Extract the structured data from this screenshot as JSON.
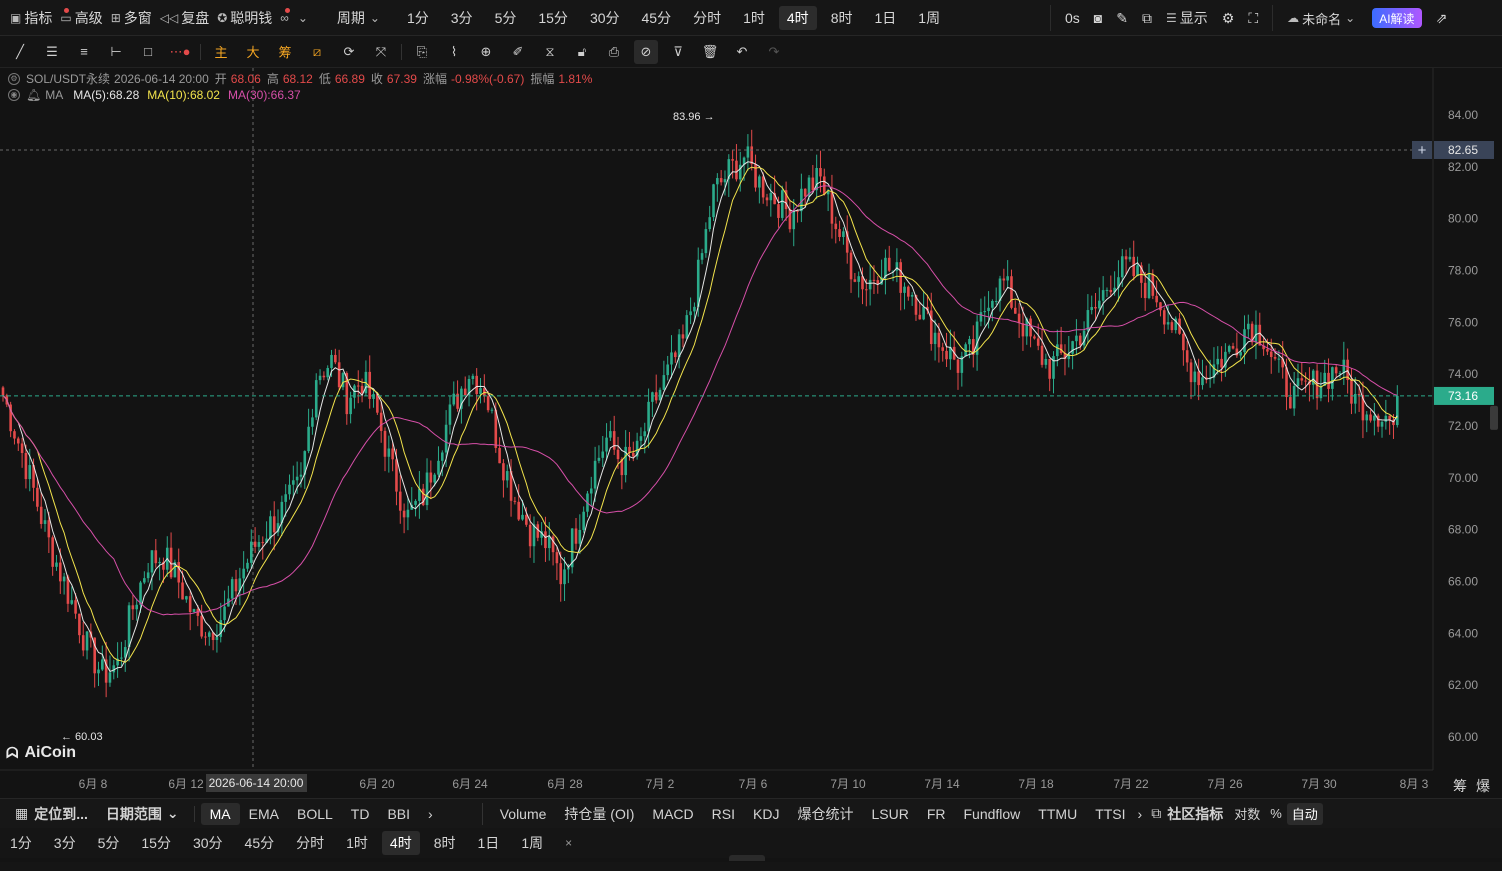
{
  "toolbar": {
    "items": [
      {
        "label": "指标",
        "icon": "indicator-icon",
        "dot": true
      },
      {
        "label": "高级",
        "icon": "advanced-icon",
        "dot": false
      },
      {
        "label": "多窗",
        "icon": "multi-window-icon",
        "dot": false
      },
      {
        "label": "复盘",
        "icon": "replay-icon",
        "dot": false
      },
      {
        "label": "聪明钱",
        "icon": "smart-money-icon",
        "dot": true
      }
    ],
    "periods_label": "周期",
    "periods": [
      "1分",
      "3分",
      "5分",
      "15分",
      "30分",
      "45分",
      "分时",
      "1时",
      "4时",
      "8时",
      "1日",
      "1周"
    ],
    "active_period": "4时",
    "countdown": "0s",
    "display_label": "显示",
    "layout_name": "未命名",
    "ai_label": "AI解读"
  },
  "legend": {
    "symbol": "SOL/USDT永续",
    "datetime": "2026-06-14 20:00",
    "open_label": "开",
    "open": "68.06",
    "high_label": "高",
    "high": "68.12",
    "low_label": "低",
    "low": "66.89",
    "close_label": "收",
    "close": "67.39",
    "change_label": "涨幅",
    "change": "-0.98%(-0.67)",
    "amp_label": "振幅",
    "amp": "1.81%",
    "ma_name": "MA",
    "ma5": "MA(5):68.28",
    "ma10": "MA(10):68.02",
    "ma30": "MA(30):66.37"
  },
  "chart_data": {
    "type": "candlestick",
    "symbol": "SOL/USDT永续",
    "interval": "4时",
    "ylim": [
      59,
      85
    ],
    "y_ticks": [
      "84.00",
      "82.00",
      "80.00",
      "78.00",
      "76.00",
      "74.00",
      "72.00",
      "70.00",
      "68.00",
      "66.00",
      "64.00",
      "62.00",
      "60.00"
    ],
    "x_ticks": [
      "6月 8",
      "6月 12",
      "6月 20",
      "6月 24",
      "6月 28",
      "7月 2",
      "7月 6",
      "7月 10",
      "7月 14",
      "7月 18",
      "7月 22",
      "7月 26",
      "7月 30",
      "8月 3"
    ],
    "crosshair_label": "2026-06-14 20:00",
    "crosshair_price": "82.65",
    "last_price": "73.16",
    "max_label": "83.96",
    "min_label": "60.03",
    "close_path": [
      [
        0,
        73.2
      ],
      [
        6,
        70.5
      ],
      [
        12,
        67.5
      ],
      [
        18,
        65.2
      ],
      [
        22,
        63.5
      ],
      [
        26,
        62.4
      ],
      [
        30,
        62.8
      ],
      [
        34,
        65.0
      ],
      [
        38,
        66.8
      ],
      [
        42,
        67.0
      ],
      [
        46,
        66.0
      ],
      [
        50,
        64.6
      ],
      [
        54,
        64.1
      ],
      [
        58,
        64.8
      ],
      [
        62,
        66.2
      ],
      [
        66,
        67.4
      ],
      [
        70,
        68.2
      ],
      [
        74,
        68.9
      ],
      [
        78,
        69.8
      ],
      [
        82,
        74.0
      ],
      [
        86,
        74.5
      ],
      [
        90,
        73.1
      ],
      [
        94,
        73.8
      ],
      [
        98,
        72.4
      ],
      [
        102,
        70.2
      ],
      [
        106,
        68.5
      ],
      [
        110,
        69.3
      ],
      [
        114,
        71.2
      ],
      [
        118,
        72.8
      ],
      [
        122,
        74.1
      ],
      [
        126,
        73.5
      ],
      [
        130,
        71.0
      ],
      [
        134,
        69.2
      ],
      [
        138,
        68.0
      ],
      [
        142,
        67.5
      ],
      [
        146,
        66.2
      ],
      [
        150,
        68.0
      ],
      [
        154,
        70.2
      ],
      [
        158,
        71.5
      ],
      [
        162,
        70.6
      ],
      [
        166,
        70.9
      ],
      [
        170,
        72.8
      ],
      [
        174,
        74.0
      ],
      [
        178,
        75.2
      ],
      [
        182,
        77.8
      ],
      [
        186,
        81.0
      ],
      [
        190,
        81.8
      ],
      [
        194,
        82.4
      ],
      [
        198,
        81.4
      ],
      [
        202,
        80.8
      ],
      [
        206,
        80.2
      ],
      [
        210,
        81.2
      ],
      [
        214,
        81.5
      ],
      [
        218,
        79.8
      ],
      [
        222,
        78.2
      ],
      [
        226,
        77.4
      ],
      [
        230,
        78.3
      ],
      [
        234,
        77.8
      ],
      [
        238,
        77.2
      ],
      [
        242,
        76.0
      ],
      [
        246,
        75.1
      ],
      [
        250,
        74.4
      ],
      [
        254,
        74.9
      ],
      [
        258,
        77.1
      ],
      [
        262,
        77.5
      ],
      [
        266,
        76.2
      ],
      [
        270,
        75.0
      ],
      [
        274,
        74.3
      ],
      [
        278,
        74.8
      ],
      [
        282,
        75.6
      ],
      [
        286,
        76.5
      ],
      [
        290,
        77.7
      ],
      [
        294,
        78.1
      ],
      [
        298,
        77.6
      ],
      [
        302,
        77.1
      ],
      [
        306,
        75.9
      ],
      [
        310,
        74.4
      ],
      [
        314,
        73.9
      ],
      [
        318,
        74.5
      ],
      [
        322,
        75.0
      ],
      [
        326,
        76.0
      ],
      [
        330,
        75.5
      ],
      [
        334,
        74.0
      ],
      [
        338,
        73.1
      ],
      [
        342,
        73.5
      ],
      [
        346,
        73.9
      ],
      [
        350,
        74.3
      ],
      [
        354,
        73.0
      ],
      [
        358,
        72.7
      ],
      [
        362,
        72.4
      ],
      [
        364,
        72.0
      ],
      [
        366,
        73.16
      ]
    ],
    "series": [
      {
        "name": "MA(5)",
        "color": "#e6e6e6",
        "value": "68.28"
      },
      {
        "name": "MA(10)",
        "color": "#f2e34c",
        "value": "68.02"
      },
      {
        "name": "MA(30)",
        "color": "#d64fa8",
        "value": "66.37"
      }
    ],
    "colors": {
      "up": "#2bab8b",
      "down": "#e34a4a",
      "ma5": "#e6e6e6",
      "ma10": "#f2e34c",
      "ma30": "#d64fa8"
    },
    "grid": false
  },
  "logo_text": "AiCoin",
  "indicators": {
    "locate_label": "定位到...",
    "date_range_label": "日期范围",
    "main": [
      "MA",
      "EMA",
      "BOLL",
      "TD",
      "BBI"
    ],
    "active_main": "MA",
    "sub": [
      "Volume",
      "持仓量 (OI)",
      "MACD",
      "RSI",
      "KDJ",
      "爆仓统计",
      "LSUR",
      "FR",
      "Fundflow",
      "TTMU",
      "TTSI"
    ],
    "community_label": "社区指标",
    "log_label": "对数",
    "percent_label": "%",
    "auto_label": "自动"
  },
  "bottom_periods": [
    "1分",
    "3分",
    "5分",
    "15分",
    "30分",
    "45分",
    "分时",
    "1时",
    "4时",
    "8时",
    "1日",
    "1周"
  ],
  "bottom_active": "4时",
  "right_side": {
    "chip_label": "筹",
    "liq_label": "爆"
  }
}
